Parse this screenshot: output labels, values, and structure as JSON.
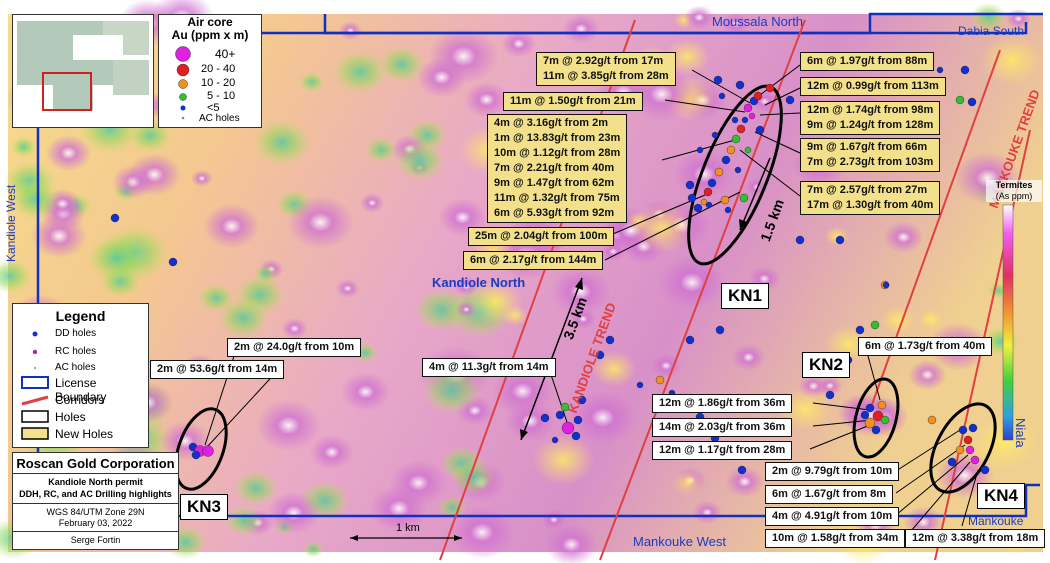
{
  "map": {
    "place_labels": {
      "moussala_north": "Moussala North",
      "dabia_south": "Dabia South",
      "kandiole_west": "Kandiole West",
      "kandiole_north": "Kandiole North",
      "mankouke_west": "Mankouke West",
      "niala": "Niala",
      "mankouke": "Mankouke"
    },
    "trend_labels": {
      "mankouke_trend": "MANKOUKE TREND",
      "kandiole_trend": "KANDIOLE TREND"
    },
    "distances": {
      "d15": "1.5 km",
      "d35": "3.5 km"
    },
    "scale_bar": "1 km",
    "zones": {
      "kn1": "KN1",
      "kn2": "KN2",
      "kn3": "KN3",
      "kn4": "KN4"
    },
    "callouts": {
      "c1": [
        "7m @ 2.92g/t from 17m",
        "11m @ 3.85g/t from 28m"
      ],
      "c2": [
        "6m @ 1.97g/t from 88m"
      ],
      "c3": [
        "12m @ 0.99g/t from 113m"
      ],
      "c4": [
        "11m @ 1.50g/t from 21m"
      ],
      "c5": [
        "12m @ 1.74g/t from 98m",
        "9m @ 1.24g/t from 128m"
      ],
      "c6": [
        "4m @ 3.16g/t from 2m",
        "1m @ 13.83g/t from 23m",
        "10m @ 1.12g/t from 28m",
        "7m @ 2.21g/t from 40m",
        "9m @ 1.47g/t from 62m",
        "11m @ 1.32g/t from 75m",
        "6m @ 5.93g/t from 92m"
      ],
      "c7": [
        "9m @ 1.67g/t from 66m",
        "7m @ 2.73g/t from 103m"
      ],
      "c8": [
        "7m @ 2.57g/t from 27m",
        "17m @ 1.30g/t from 40m"
      ],
      "c9": [
        "25m @ 2.04g/t from 100m"
      ],
      "c10": [
        "6m @ 2.17g/t from 144m"
      ],
      "c11": [
        "2m @ 24.0g/t from 10m"
      ],
      "c12": [
        "2m @ 53.6g/t from 14m"
      ],
      "c13": [
        "4m @ 11.3g/t from 14m"
      ],
      "c14": [
        "6m @ 1.73g/t from 40m"
      ],
      "c15": [
        "12m @ 1.86g/t from 36m"
      ],
      "c16": [
        "14m @ 2.03g/t from 36m"
      ],
      "c17": [
        "12m @ 1.17g/t from 28m"
      ],
      "c18": [
        "2m @ 9.79g/t from 10m"
      ],
      "c19": [
        "6m @ 1.67g/t from 8m"
      ],
      "c20": [
        "4m @ 4.91g/t from 10m"
      ],
      "c21": [
        "10m @ 1.58g/t from 34m"
      ],
      "c22": [
        "12m @ 3.38g/t from 18m"
      ]
    }
  },
  "aircore_legend": {
    "title_line1": "Air core",
    "title_line2": "Au (ppm x m)",
    "items": [
      "40+",
      "20 - 40",
      "10 - 20",
      "5 - 10",
      "<5",
      "AC holes"
    ],
    "colors": [
      "#e020e0",
      "#e02020",
      "#f0901e",
      "#30c030",
      "#1030d0",
      "#888888"
    ]
  },
  "termites_legend": {
    "title": "Termites",
    "unit": "(As ppm)"
  },
  "legend": {
    "title": "Legend",
    "items": [
      "DD holes",
      "RC holes",
      "AC holes",
      "License Boundary",
      "Corridors",
      "Holes",
      "New Holes"
    ]
  },
  "title_block": {
    "company": "Roscan Gold Corporation",
    "subtitle1": "Kandiole North permit",
    "subtitle2": "DDH, RC, and AC Drilling highlights",
    "crs": "WGS 84/UTM Zone 29N",
    "date": "February 03, 2022",
    "author": "Serge Fortin"
  },
  "colors": {
    "license_boundary": "#1030c0",
    "corridor": "#e04040",
    "new_holes": "#f2e08a",
    "place_label": "#1a3cc0"
  }
}
